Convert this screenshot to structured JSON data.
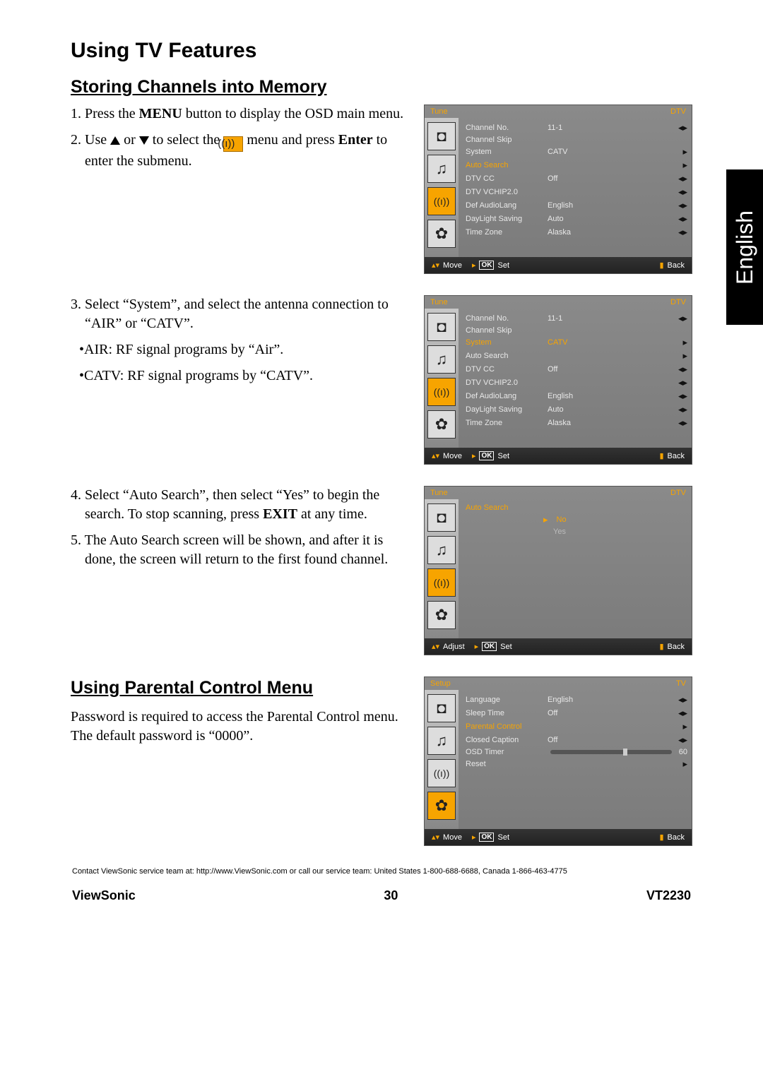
{
  "lang_tab": "English",
  "title": "Using TV Features",
  "section1": {
    "heading": "Storing Channels into Memory",
    "step1a": "1. Press the ",
    "step1b": "MENU",
    "step1c": " button to display the OSD main menu.",
    "step2a": "2. Use ",
    "step2b": " or ",
    "step2c": " to select the ",
    "step2d": " menu and press ",
    "step2e": "Enter",
    "step2f": " to enter the submenu.",
    "step3": "3. Select “System”, and select the antenna connection to “AIR” or “CATV”.",
    "bullet1": "•AIR: RF signal programs by “Air”.",
    "bullet2": "•CATV: RF signal programs by “CATV”.",
    "step4a": "4. Select “Auto Search”, then select “Yes” to begin the search. To stop scanning, press ",
    "step4b": "EXIT",
    "step4c": " at any time.",
    "step5": "5. The Auto Search screen will be shown, and after it is done, the screen will return to the first found channel."
  },
  "section2": {
    "heading": "Using Parental Control Menu",
    "body": "Password is required to access the Parental Control menu. The default password is “0000”."
  },
  "osd_common": {
    "foot_move": "Move",
    "foot_adjust": "Adjust",
    "foot_set": "Set",
    "foot_back": "Back",
    "foot_ok": "OK"
  },
  "osd1": {
    "top_left": "Tune",
    "top_right": "DTV",
    "hl_row": 3,
    "rows": [
      {
        "l": "Channel No.",
        "v": "11-1",
        "a": "lr"
      },
      {
        "l": "Channel Skip",
        "v": "",
        "a": ""
      },
      {
        "l": "System",
        "v": "CATV",
        "a": "r"
      },
      {
        "l": "Auto Search",
        "v": "",
        "a": "r"
      },
      {
        "l": "DTV CC",
        "v": "Off",
        "a": "lr"
      },
      {
        "l": "DTV VCHIP2.0",
        "v": "",
        "a": "lr"
      },
      {
        "l": "Def AudioLang",
        "v": "English",
        "a": "lr"
      },
      {
        "l": "DayLight Saving",
        "v": "Auto",
        "a": "lr"
      },
      {
        "l": "Time Zone",
        "v": "Alaska",
        "a": "lr"
      }
    ]
  },
  "osd2": {
    "top_left": "Tune",
    "top_right": "DTV",
    "hl_row": 2,
    "rows": [
      {
        "l": "Channel No.",
        "v": "11-1",
        "a": "lr"
      },
      {
        "l": "Channel Skip",
        "v": "",
        "a": ""
      },
      {
        "l": "System",
        "v": "CATV",
        "a": "r"
      },
      {
        "l": "Auto Search",
        "v": "",
        "a": "r"
      },
      {
        "l": "DTV CC",
        "v": "Off",
        "a": "lr"
      },
      {
        "l": "DTV VCHIP2.0",
        "v": "",
        "a": "lr"
      },
      {
        "l": "Def AudioLang",
        "v": "English",
        "a": "lr"
      },
      {
        "l": "DayLight Saving",
        "v": "Auto",
        "a": "lr"
      },
      {
        "l": "Time Zone",
        "v": "Alaska",
        "a": "lr"
      }
    ]
  },
  "osd3": {
    "top_left": "Tune",
    "top_right": "DTV",
    "heading": "Auto Search",
    "opt_no": "No",
    "opt_yes": "Yes"
  },
  "osd4": {
    "top_left": "Setup",
    "top_right": "TV",
    "hl_row": 2,
    "rows": [
      {
        "l": "Language",
        "v": "English",
        "a": "lr"
      },
      {
        "l": "Sleep Time",
        "v": "Off",
        "a": "lr"
      },
      {
        "l": "Parental Control",
        "v": "",
        "a": "r"
      },
      {
        "l": "Closed Caption",
        "v": "Off",
        "a": "lr"
      },
      {
        "l": "OSD Timer",
        "v": "",
        "a": "slider",
        "sv": "60"
      },
      {
        "l": "Reset",
        "v": "",
        "a": "r"
      }
    ]
  },
  "contact": "Contact ViewSonic service team at: http://www.ViewSonic.com or call our service team: United States 1-800-688-6688, Canada 1-866-463-4775",
  "footer": {
    "left": "ViewSonic",
    "center": "30",
    "right": "VT2230"
  }
}
